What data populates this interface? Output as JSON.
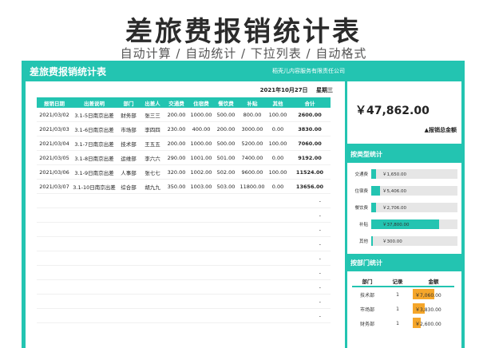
{
  "hero": {
    "title": "差旅费报销统计表",
    "subtitle": "自动计算 / 自动统计 / 下拉列表 / 自动格式"
  },
  "sheet": {
    "title": "差旅费报销统计表",
    "company": "稻壳儿内容服务有限责任公司",
    "date": "2021年10月27日",
    "weekday": "星期三"
  },
  "table": {
    "headers": [
      "报销日期",
      "出差说明",
      "部门",
      "出差人",
      "交通费",
      "住宿费",
      "餐饮费",
      "补贴",
      "其他",
      "合计"
    ],
    "rows": [
      [
        "2021/03/02",
        "3.1-5日南京出差",
        "财务部",
        "张三三",
        "200.00",
        "1000.00",
        "500.00",
        "800.00",
        "100.00",
        "2600.00"
      ],
      [
        "2021/03/03",
        "3.1-6日南京出差",
        "市场部",
        "李四四",
        "230.00",
        "400.00",
        "200.00",
        "3000.00",
        "0.00",
        "3830.00"
      ],
      [
        "2021/03/04",
        "3.1-7日南京出差",
        "技术部",
        "王五五",
        "200.00",
        "1000.00",
        "500.00",
        "5200.00",
        "100.00",
        "7060.00"
      ],
      [
        "2021/03/05",
        "3.1-8日南京出差",
        "运维部",
        "李六六",
        "290.00",
        "1001.00",
        "501.00",
        "7400.00",
        "0.00",
        "9192.00"
      ],
      [
        "2021/03/06",
        "3.1-9日南京出差",
        "人事部",
        "张七七",
        "320.00",
        "1002.00",
        "502.00",
        "9600.00",
        "100.00",
        "11524.00"
      ],
      [
        "2021/03/07",
        "3.1-10日南京出差",
        "综合部",
        "胡九九",
        "350.00",
        "1003.00",
        "503.00",
        "11800.00",
        "0.00",
        "13656.00"
      ]
    ],
    "empty_rows": 9,
    "empty_total": "-"
  },
  "summary": {
    "value": "￥47,862.00",
    "label": "▲报销总金额"
  },
  "by_type": {
    "title": "按类型统计",
    "items": [
      {
        "label": "交通费",
        "value": "￥1,650.00",
        "fraction": 0.06
      },
      {
        "label": "住宿费",
        "value": "￥5,406.00",
        "fraction": 0.1
      },
      {
        "label": "餐饮费",
        "value": "￥2,706.00",
        "fraction": 0.06
      },
      {
        "label": "补贴",
        "value": "￥37,800.00",
        "fraction": 0.79
      },
      {
        "label": "其他",
        "value": "￥300.00",
        "fraction": 0.02
      }
    ]
  },
  "by_dept": {
    "title": "按部门统计",
    "headers": [
      "部门",
      "记录",
      "金额"
    ],
    "rows": [
      {
        "dept": "技术部",
        "count": "1",
        "amount": "￥7,060.00",
        "fraction": 0.52
      },
      {
        "dept": "市场部",
        "count": "1",
        "amount": "￥3,830.00",
        "fraction": 0.28
      },
      {
        "dept": "财务部",
        "count": "1",
        "amount": "￥2,600.00",
        "fraction": 0.19
      }
    ]
  },
  "colors": {
    "accent": "#23c4b1",
    "orange": "#f5a62a"
  }
}
